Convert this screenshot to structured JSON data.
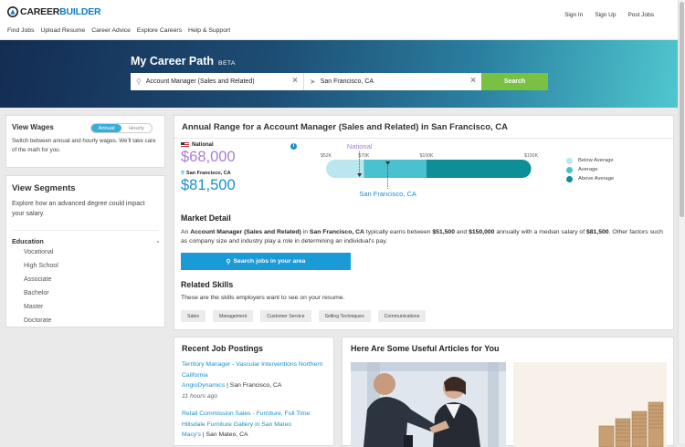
{
  "brand": {
    "name_part1": "CAREER",
    "name_part2": "BUILDER"
  },
  "utility_nav": [
    "Sign In",
    "Sign Up",
    "Post Jobs"
  ],
  "main_nav": [
    "Find Jobs",
    "Upload Resume",
    "Career Advice",
    "Explore Careers",
    "Help & Support"
  ],
  "hero": {
    "title": "My Career Path",
    "badge": "BETA",
    "job_value": "Account Manager (Sales and Related)",
    "location_value": "San Francisco, CA",
    "search_label": "Search"
  },
  "wages": {
    "title": "View Wages",
    "toggle_on": "Annual",
    "toggle_off": "Hourly",
    "description": "Switch between annual and hourly wages. We'll take care of the math for you."
  },
  "segments": {
    "title": "View Segments",
    "description": "Explore how an advanced degree could impact your salary.",
    "group_label": "Education",
    "group_toggle": "-",
    "items": [
      "Vocational",
      "High School",
      "Associate",
      "Bachelor",
      "Master",
      "Doctorate"
    ]
  },
  "range": {
    "title": "Annual Range for a Account Manager (Sales and Related) in San Francisco, CA",
    "national_label": "National",
    "national_salary": "$68,000",
    "local_label": "San Francisco, CA",
    "local_salary": "$81,500",
    "info_glyph": "i"
  },
  "chart_data": {
    "type": "bar",
    "orientation": "horizontal-range",
    "axis_min": 45000,
    "axis_max": 155000,
    "ticks": [
      {
        "label": "$52K",
        "value": 52000
      },
      {
        "label": "$70K",
        "value": 70000
      },
      {
        "label": "$100K",
        "value": 100000
      },
      {
        "label": "$150K",
        "value": 150000
      }
    ],
    "segments": [
      {
        "name": "Below Average",
        "from": 52000,
        "to": 70000,
        "color": "#b9e6ef"
      },
      {
        "name": "Average",
        "from": 70000,
        "to": 100000,
        "color": "#49c1cf"
      },
      {
        "name": "Above Average",
        "from": 100000,
        "to": 150000,
        "color": "#0e8f97"
      }
    ],
    "markers": [
      {
        "label": "National",
        "value": 68000,
        "position": "above",
        "color": "#a97ed2"
      },
      {
        "label": "San Francisco, CA",
        "value": 81500,
        "position": "below",
        "color": "#1a8fc7"
      }
    ],
    "legend": [
      "Below Average",
      "Average",
      "Above Average"
    ],
    "legend_placement": "right"
  },
  "market": {
    "title": "Market Detail",
    "p1": "An ",
    "job": "Account Manager (Sales and Related)",
    "p2": " in ",
    "loc": "San Francisco, CA",
    "p3": " typically earns between ",
    "low": "$51,500",
    "p4": " and ",
    "high": "$150,000",
    "p5": " annually with a median salary of ",
    "median": "$81,500",
    "p6": ". Other factors such as company size and industry play a role in determining an individual's pay.",
    "button": "Search jobs in your area"
  },
  "skills": {
    "title": "Related Skills",
    "subtitle": "These are the skills employers want to see on your resume.",
    "items": [
      "Sales",
      "Management",
      "Customer Service",
      "Selling Techniques",
      "Communications"
    ]
  },
  "postings": {
    "title": "Recent Job Postings",
    "items": [
      {
        "title": "Territory Manager - Vascular Interventions Northern California",
        "company": "AngioDynamics",
        "sep": " | ",
        "location": "San Francisco, CA",
        "ago": "11 hours ago"
      },
      {
        "title": "Retail Commission Sales - Furniture, Full Time: Hillsdale Furniture Gallery in San Mateo",
        "company": "Macy's",
        "sep": " | ",
        "location": "San Mateo, CA",
        "ago": ""
      }
    ]
  },
  "articles": {
    "title": "Here Are Some Useful Articles for You"
  }
}
